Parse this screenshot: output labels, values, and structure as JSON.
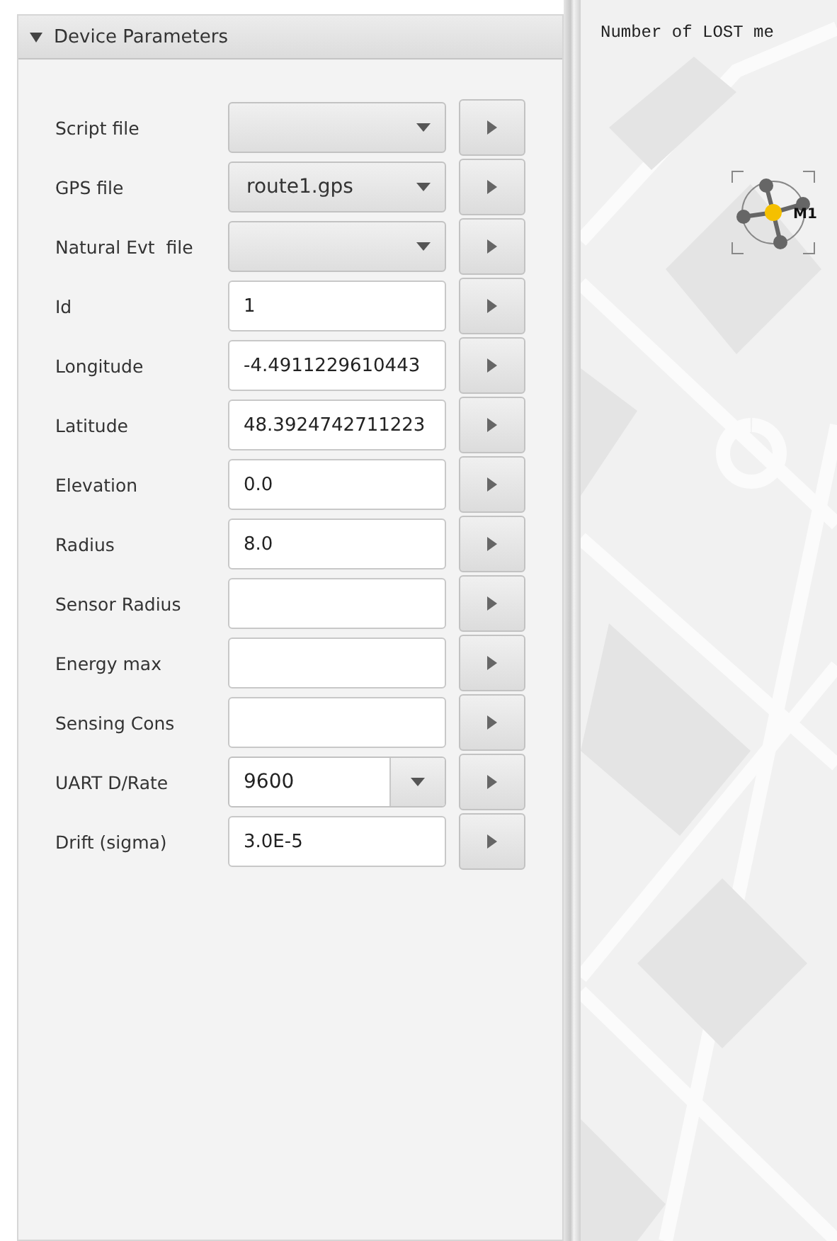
{
  "panel": {
    "title": "Device Parameters",
    "expanded": true
  },
  "rows": [
    {
      "label": "Script file",
      "kind": "combo",
      "value": ""
    },
    {
      "label": "GPS file",
      "kind": "combo",
      "value": "route1.gps"
    },
    {
      "label": "Natural Evt  file",
      "kind": "combo",
      "value": ""
    },
    {
      "label": "Id",
      "kind": "field",
      "value": "1"
    },
    {
      "label": "Longitude",
      "kind": "field",
      "value": "-4.4911229610443"
    },
    {
      "label": "Latitude",
      "kind": "field",
      "value": "48.3924742711223"
    },
    {
      "label": "Elevation",
      "kind": "field",
      "value": "0.0"
    },
    {
      "label": "Radius",
      "kind": "field",
      "value": "8.0"
    },
    {
      "label": "Sensor Radius",
      "kind": "field",
      "value": ""
    },
    {
      "label": "Energy max",
      "kind": "field",
      "value": ""
    },
    {
      "label": "Sensing Cons",
      "kind": "field",
      "value": ""
    },
    {
      "label": "UART D/Rate",
      "kind": "editable-combo",
      "value": "9600"
    },
    {
      "label": "Drift (sigma)",
      "kind": "field",
      "value": "3.0E-5"
    }
  ],
  "map": {
    "console_line": "Number of LOST me",
    "marker_label": "M1"
  }
}
